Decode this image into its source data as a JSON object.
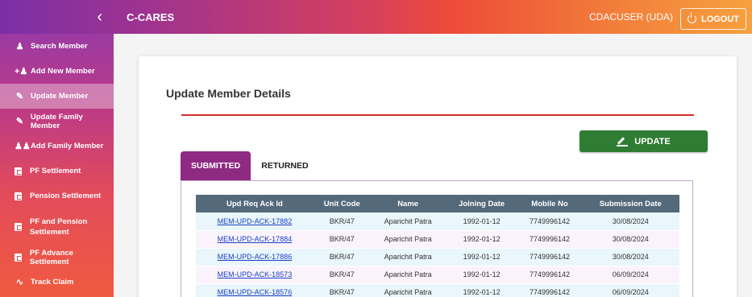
{
  "topbar": {
    "collapse_icon": "‹",
    "title": "C-CARES",
    "user": "CDACUSER (UDA)",
    "logout_label": "LOGOUT"
  },
  "sidebar": {
    "items": [
      {
        "label": "Search Member",
        "icon": "search-user-icon"
      },
      {
        "label": "Add New Member",
        "icon": "add-user-icon"
      },
      {
        "label": "Update Member",
        "icon": "edit-icon"
      },
      {
        "label": "Update Family Member",
        "icon": "edit-icon"
      },
      {
        "label": "Add Family Member",
        "icon": "group-icon"
      },
      {
        "label": "PF Settlement",
        "icon": "pf-icon"
      },
      {
        "label": "Pension Settlement",
        "icon": "pf-icon"
      },
      {
        "label": "PF and Pension Settlement",
        "icon": "pf-icon"
      },
      {
        "label": "PF Advance Settlement",
        "icon": "pf-icon"
      },
      {
        "label": "Track Claim",
        "icon": "trend-icon"
      }
    ]
  },
  "main": {
    "heading": "Update Member Details",
    "update_label": "UPDATE",
    "tabs": [
      {
        "label": "SUBMITTED"
      },
      {
        "label": "RETURNED"
      }
    ],
    "table": {
      "headers": [
        "Upd Req Ack Id",
        "Unit Code",
        "Name",
        "Joining Date",
        "Mobile No",
        "Submission Date"
      ],
      "rows": [
        [
          "MEM-UPD-ACK-17882",
          "BKR/47",
          "Aparichit Patra",
          "1992-01-12",
          "7749996142",
          "30/08/2024"
        ],
        [
          "MEM-UPD-ACK-17884",
          "BKR/47",
          "Aparichit Patra",
          "1992-01-12",
          "7749996142",
          "30/08/2024"
        ],
        [
          "MEM-UPD-ACK-17886",
          "BKR/47",
          "Aparichit Patra",
          "1992-01-12",
          "7749996142",
          "30/08/2024"
        ],
        [
          "MEM-UPD-ACK-18573",
          "BKR/47",
          "Aparichit Patra",
          "1992-01-12",
          "7749996142",
          "06/09/2024"
        ],
        [
          "MEM-UPD-ACK-18576",
          "BKR/47",
          "Aparichit Patra",
          "1992-01-12",
          "7749996142",
          "06/09/2024"
        ]
      ]
    }
  },
  "colors": {
    "sidebar_active": "#d9a2c9",
    "update_button": "#2e7d32",
    "active_tab": "#8e2a82",
    "table_header": "#546a7b",
    "divider": "#d32f2f"
  }
}
